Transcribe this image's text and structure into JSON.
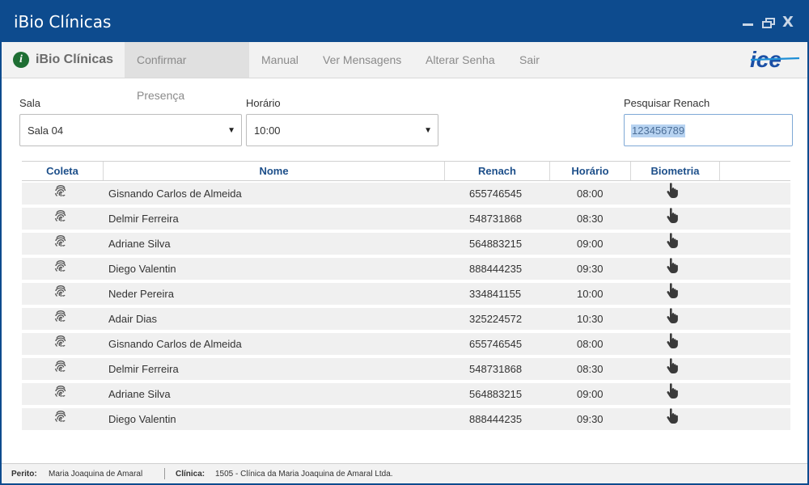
{
  "window": {
    "title": "iBio Clínicas",
    "controls": [
      "minimize-icon",
      "restore-icon",
      "close-icon"
    ],
    "close_label": "X"
  },
  "menubar": {
    "brand": "iBio Clínicas",
    "brand_icon": "info-icon",
    "items": [
      "Confirmar Presença",
      "Manual",
      "Ver Mensagens",
      "Alterar Senha",
      "Sair"
    ],
    "active_index": 0,
    "logo_text": "ice"
  },
  "filters": {
    "sala_label": "Sala",
    "sala_value": "Sala 04",
    "horario_label": "Horário",
    "horario_value": "10:00",
    "search_label": "Pesquisar Renach",
    "search_value": "123456789"
  },
  "table": {
    "columns": [
      "Coleta",
      "Nome",
      "Renach",
      "Horário",
      "Biometria"
    ],
    "rows": [
      {
        "nome": "Gisnando Carlos de Almeida",
        "renach": "655746545",
        "horario": "08:00"
      },
      {
        "nome": "Delmir Ferreira",
        "renach": "548731868",
        "horario": "08:30"
      },
      {
        "nome": "Adriane Silva",
        "renach": "564883215",
        "horario": "09:00"
      },
      {
        "nome": "Diego Valentin",
        "renach": "888444235",
        "horario": "09:30"
      },
      {
        "nome": "Neder Pereira",
        "renach": "334841155",
        "horario": "10:00"
      },
      {
        "nome": "Adair Dias",
        "renach": "325224572",
        "horario": "10:30"
      },
      {
        "nome": "Gisnando Carlos de Almeida",
        "renach": "655746545",
        "horario": "08:00"
      },
      {
        "nome": "Delmir Ferreira",
        "renach": "548731868",
        "horario": "08:30"
      },
      {
        "nome": "Adriane Silva",
        "renach": "564883215",
        "horario": "09:00"
      },
      {
        "nome": "Diego Valentin",
        "renach": "888444235",
        "horario": "09:30"
      }
    ],
    "coleta_icon": "fingerprint-icon",
    "biometria_icon": "hand-pointer-icon"
  },
  "status": {
    "perito_label": "Perito:",
    "perito_value": "Maria Joaquina de Amaral",
    "clinica_label": "Clínica:",
    "clinica_value": "1505 - Clínica da Maria Joaquina de Amaral Ltda."
  },
  "colors": {
    "primary": "#0d4b8e",
    "header_text": "#1d4f8a",
    "row_bg": "#f0f0f0"
  }
}
